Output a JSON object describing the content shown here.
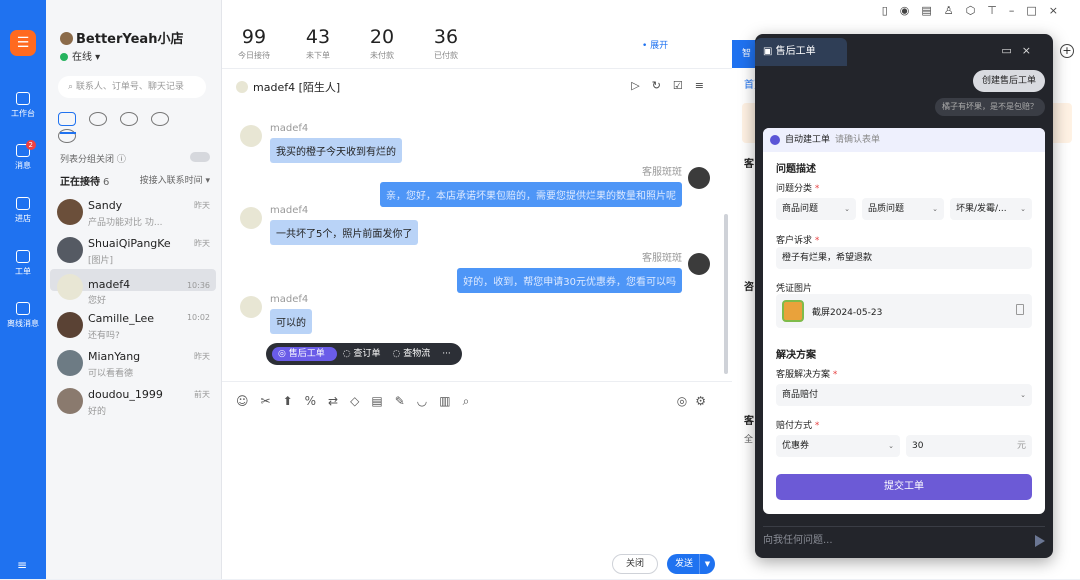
{
  "rail": {
    "items": [
      {
        "label": "工作台"
      },
      {
        "label": "消息",
        "badge": "2"
      },
      {
        "label": "进店"
      },
      {
        "label": "工单"
      },
      {
        "label": "离线消息"
      }
    ],
    "menu": "≡"
  },
  "shop": {
    "name": "BetterYeah小店",
    "status": "在线"
  },
  "search": {
    "placeholder": "联系人、订单号、聊天记录"
  },
  "contacts_panel": {
    "group_label": "列表分组关闭",
    "waiting_label": "正在接待",
    "waiting_count": "6",
    "sort_label": "按接入联系时间"
  },
  "contacts": [
    {
      "name": "Sandy",
      "preview": "产品功能对比 功...",
      "time": "昨天",
      "avatar": "#6b4f3a"
    },
    {
      "name": "ShuaiQiPangKe",
      "preview": "[图片]",
      "time": "昨天",
      "avatar": "#555a63"
    },
    {
      "name": "madef4",
      "preview": "您好",
      "time": "10:36",
      "avatar": "#e8e6d4"
    },
    {
      "name": "Camille_Lee",
      "preview": "还有吗?",
      "time": "10:02",
      "avatar": "#5a4234"
    },
    {
      "name": "MianYang",
      "preview": "可以看看德",
      "time": "昨天",
      "avatar": "#6d7b84"
    },
    {
      "name": "doudou_1999",
      "preview": "好的",
      "time": "前天",
      "avatar": "#8a7a6e"
    }
  ],
  "stats": [
    {
      "value": "99",
      "label": "今日接待"
    },
    {
      "value": "43",
      "label": "未下单"
    },
    {
      "value": "20",
      "label": "未付款"
    },
    {
      "value": "36",
      "label": "已付款"
    }
  ],
  "expand_label": "展开",
  "chat": {
    "header": "madef4 [陌生人]",
    "messages": [
      {
        "from": "customer",
        "name": "madef4",
        "text": "我买的橙子今天收到有烂的"
      },
      {
        "from": "agent",
        "name": "客服斑斑",
        "text": "亲，您好，本店承诺坏果包赔的，需要您提供烂果的数量和照片呢"
      },
      {
        "from": "customer",
        "name": "madef4",
        "text": "一共坏了5个，照片前面发你了"
      },
      {
        "from": "agent",
        "name": "客服斑斑",
        "text": "好的，收到，帮您申请30元优惠券，您看可以吗"
      },
      {
        "from": "customer",
        "name": "madef4",
        "text": "可以的"
      }
    ],
    "quick_actions": [
      "售后工单",
      "查订单",
      "查物流",
      "···"
    ]
  },
  "editor": {
    "close_label": "关闭",
    "send_label": "发送"
  },
  "right_panel": {
    "tab": "智",
    "sub_tab": "首页",
    "labels": [
      "客",
      "咨",
      "客"
    ],
    "all_label": "全"
  },
  "overlay": {
    "title": "售后工单",
    "create_button": "创建售后工单",
    "suggest_tip": "橘子有坏果，是不是包赔？",
    "form_header": "自动建工单",
    "form_hint": "请确认表单",
    "section_problem": "问题描述",
    "category_label": "问题分类",
    "categories": [
      "商品问题",
      "品质问题",
      "坏果/发霉/..."
    ],
    "appeal_label": "客户诉求",
    "appeal_value": "橙子有烂果，希望退款",
    "evidence_label": "凭证图片",
    "evidence_file": "截屏2024-05-23",
    "section_solution": "解决方案",
    "solution_label": "客服解决方案",
    "solution_value": "商品赔付",
    "comp_label": "赔付方式",
    "comp_type": "优惠券",
    "comp_amount": "30",
    "comp_unit": "元",
    "submit_label": "提交工单",
    "input_placeholder": "向我任何问题..."
  }
}
